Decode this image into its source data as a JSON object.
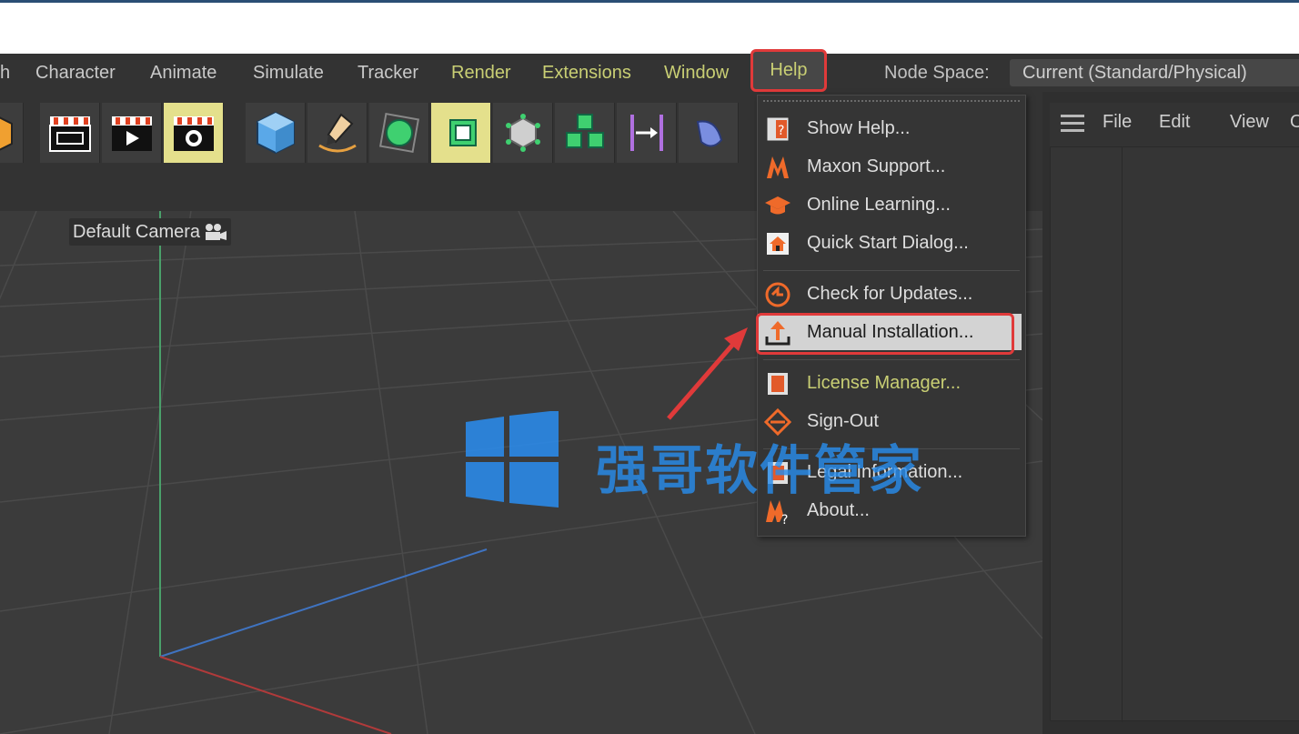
{
  "menubar": {
    "items": [
      {
        "label": "h",
        "accent": false
      },
      {
        "label": "Character",
        "accent": false
      },
      {
        "label": "Animate",
        "accent": false
      },
      {
        "label": "Simulate",
        "accent": false
      },
      {
        "label": "Tracker",
        "accent": false
      },
      {
        "label": "Render",
        "accent": true
      },
      {
        "label": "Extensions",
        "accent": true
      },
      {
        "label": "Window",
        "accent": true
      }
    ],
    "help_label": "Help",
    "node_space_label": "Node Space:",
    "node_space_value": "Current (Standard/Physical)"
  },
  "toolbar": {
    "buttons": [
      {
        "icon": "cube-partial-icon"
      },
      {
        "icon": "render-view-clapper-icon"
      },
      {
        "icon": "render-to-picture-viewer-icon"
      },
      {
        "icon": "render-settings-icon",
        "active": true
      },
      {
        "icon": "cube-object-icon"
      },
      {
        "icon": "pen-spline-icon"
      },
      {
        "icon": "subdivision-surface-icon"
      },
      {
        "icon": "extrude-generator-icon",
        "active": true
      },
      {
        "icon": "cloner-icon"
      },
      {
        "icon": "mograph-cubes-icon"
      },
      {
        "icon": "deformer-bend-icon"
      },
      {
        "icon": "field-icon"
      }
    ]
  },
  "viewport": {
    "camera_label": "Default Camera"
  },
  "right_panel": {
    "menu": [
      "File",
      "Edit",
      "View",
      "O"
    ]
  },
  "help_menu": {
    "items": [
      {
        "label": "Show Help...",
        "icon": "show-help-icon"
      },
      {
        "label": "Maxon Support...",
        "icon": "maxon-logo-icon"
      },
      {
        "label": "Online Learning...",
        "icon": "graduation-cap-icon"
      },
      {
        "label": "Quick Start Dialog...",
        "icon": "home-icon"
      },
      {
        "label": "Check for Updates...",
        "icon": "update-check-icon"
      },
      {
        "label": "Manual Installation...",
        "icon": "manual-install-icon",
        "highlighted": true
      },
      {
        "label": "License Manager...",
        "icon": "license-manager-icon",
        "accent": true
      },
      {
        "label": "Sign-Out",
        "icon": "sign-out-icon"
      },
      {
        "label": "Legal Information...",
        "icon": "legal-info-icon"
      },
      {
        "label": "About...",
        "icon": "about-icon"
      }
    ]
  },
  "colors": {
    "accent_yellow": "#c9cf74",
    "annotation_red": "#e03a3a",
    "watermark_blue": "#288ceb"
  },
  "watermark": {
    "text": "强哥软件管家"
  }
}
